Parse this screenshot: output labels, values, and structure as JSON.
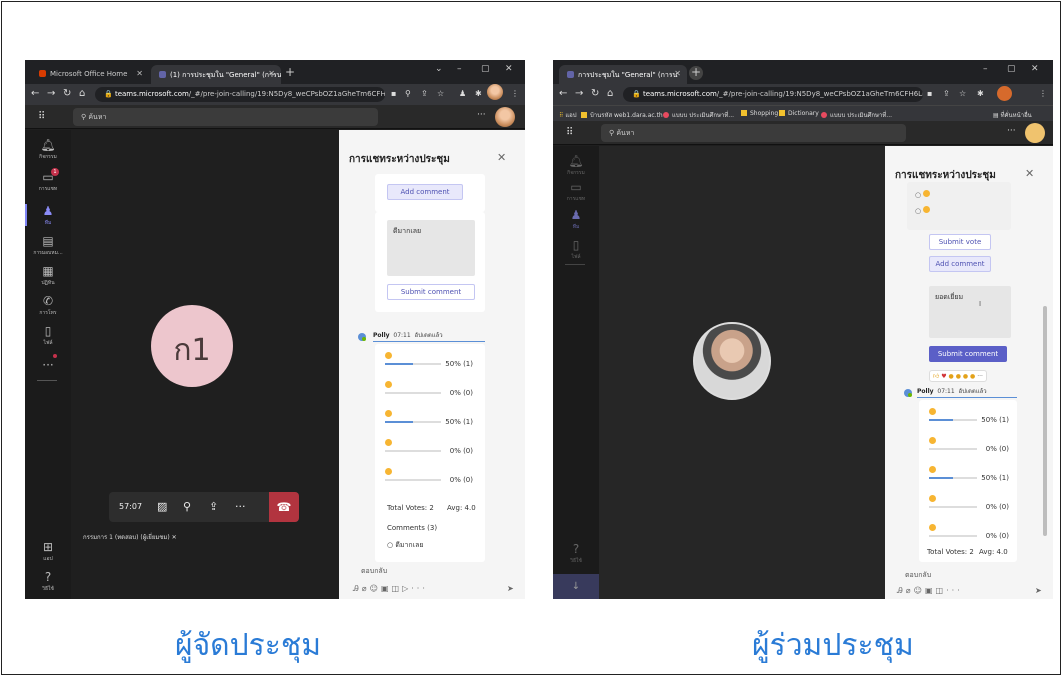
{
  "captions": {
    "organizer": "ผู้จัดประชุม",
    "participant": "ผู้ร่วมประชุม"
  },
  "organizer": {
    "tabs": [
      {
        "label": "Microsoft Office Home",
        "color": "#d83b01"
      },
      {
        "label": "(1) การประชุมใน \"General\" (การน",
        "color": "#6264a7"
      }
    ],
    "url_host": "teams.microsoft.com",
    "url_path": "/_#/pre-join-calling/19:N5Dy8_weCPsbOZ1aGheTm6CFH6LL...",
    "search_placeholder": "ค้นหา",
    "rail": [
      {
        "label": "กิจกรรม",
        "icon": "bell-icon"
      },
      {
        "label": "การแชท",
        "icon": "chat-icon",
        "badge": "1"
      },
      {
        "label": "ทีม",
        "icon": "teams-icon"
      },
      {
        "label": "การมอบหม...",
        "icon": "assignments-icon"
      },
      {
        "label": "ปฏิทิน",
        "icon": "calendar-icon"
      },
      {
        "label": "การโทร",
        "icon": "phone-icon"
      },
      {
        "label": "ไฟล์",
        "icon": "file-icon"
      },
      {
        "label": "",
        "icon": "more-icon"
      }
    ],
    "rail_bottom": [
      {
        "label": "แอป",
        "icon": "apps-icon"
      },
      {
        "label": "วิธีใช้",
        "icon": "help-icon"
      }
    ],
    "avatar_initials": "ก1",
    "timer": "57:07",
    "name_tag": "กรรมการ 1 (ทดสอบ) (ผู้เยี่ยมชม)",
    "chat": {
      "title": "การแชทระหว่างประชุม",
      "add_comment": "Add comment",
      "comment_text": "ดีมากเลย",
      "submit_comment": "Submit comment",
      "sender": "Polly",
      "time": "07:11",
      "edited": "อัปเดตแล้ว",
      "options": [
        {
          "pct": "50% (1)",
          "value": 0.5
        },
        {
          "pct": "0% (0)",
          "value": 0
        },
        {
          "pct": "50% (1)",
          "value": 0.5
        },
        {
          "pct": "0% (0)",
          "value": 0
        },
        {
          "pct": "0% (0)",
          "value": 0
        }
      ],
      "total_votes": "Total Votes: 2",
      "avg": "Avg: 4.0",
      "comments_count": "Comments (3)",
      "comment_item": "ดีมากเลย",
      "reply_placeholder": "ตอบกลับ"
    }
  },
  "participant": {
    "tabs": [
      {
        "label": "การประชุมใน \"General\" (การน",
        "color": "#6264a7"
      }
    ],
    "url_host": "teams.microsoft.com",
    "url_path": "/_#/pre-join-calling/19:N5Dy8_weCPsbOZ1aGheTm6CFH6LLQQHXeAQ...",
    "bookmarks": [
      "แอป",
      "บ้านรหัส web1.dara.ac.th",
      "แบบบ ประเมินศึกษาที่...",
      "Shopping",
      "Dictionary",
      "แบบบ ประเมินศึกษาที่..."
    ],
    "bookmark_right": "ที่คั่นหน้าอื่น",
    "search_placeholder": "ค้นหา",
    "rail": [
      {
        "label": "กิจกรรม",
        "icon": "bell-icon"
      },
      {
        "label": "การแชท",
        "icon": "chat-icon"
      },
      {
        "label": "ทีม",
        "icon": "teams-icon"
      },
      {
        "label": "ไฟล์",
        "icon": "file-icon"
      }
    ],
    "rail_bottom": [
      {
        "label": "วิธีใช้",
        "icon": "help-icon"
      }
    ],
    "chat": {
      "title": "การแชทระหว่างประชุม",
      "submit_vote": "Submit vote",
      "add_comment": "Add comment",
      "comment_text": "ยอดเยี่ยม",
      "submit_comment": "Submit comment",
      "sender": "Polly",
      "time": "07:11",
      "edited": "อัปเดตแล้ว",
      "options": [
        {
          "pct": "50% (1)",
          "value": 0.5
        },
        {
          "pct": "0% (0)",
          "value": 0
        },
        {
          "pct": "50% (1)",
          "value": 0.5
        },
        {
          "pct": "0% (0)",
          "value": 0
        },
        {
          "pct": "0% (0)",
          "value": 0
        }
      ],
      "total_votes": "Total Votes: 2",
      "avg": "Avg: 4.0",
      "reply_placeholder": "ตอบกลับ"
    }
  },
  "colors": {
    "accent": "#5b5fc7",
    "caption": "#2a7bd6",
    "hangup": "#b2343f",
    "avatar_bg": "#edc6cd"
  }
}
